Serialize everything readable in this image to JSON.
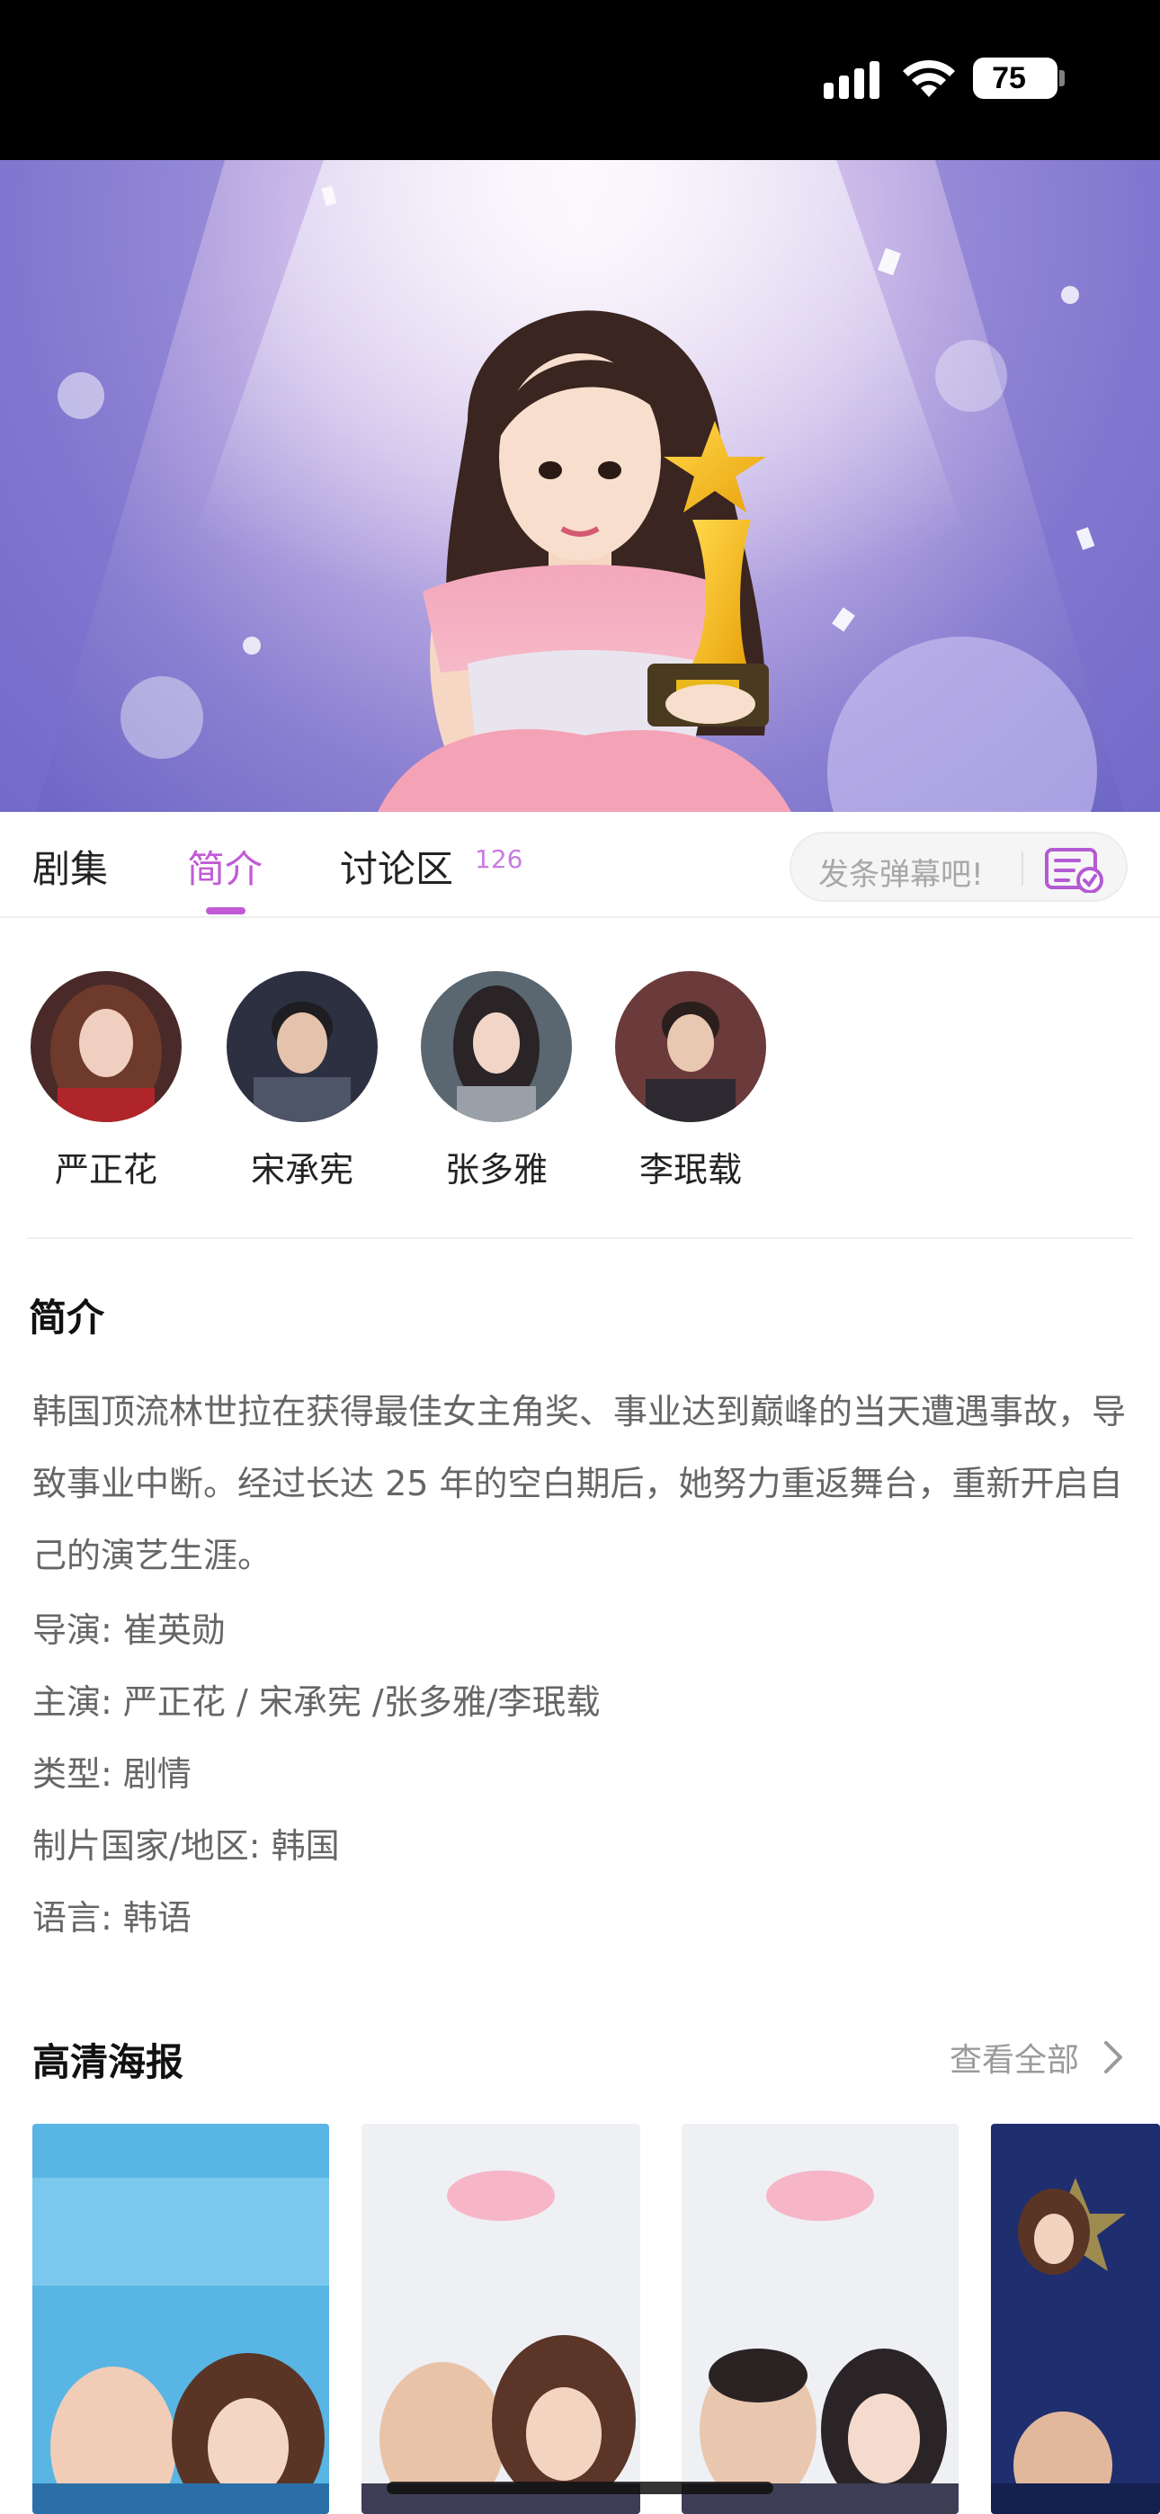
{
  "status_bar": {
    "battery": "75"
  },
  "tabs": {
    "episodes": "剧集",
    "intro": "简介",
    "discussion": "讨论区",
    "discussion_count": "126",
    "danmaku_placeholder": "发条弹幕吧!"
  },
  "cast": [
    "严正花",
    "宋承宪",
    "张多雅",
    "李珉载"
  ],
  "intro": {
    "title": "简介",
    "description": "韩国顶流林世拉在获得最佳女主角奖、事业达到巅峰的当天遭遇事故，导致事业中断。经过长达 25 年的空白期后，她努力重返舞台，重新开启自己的演艺生涯。",
    "director": "导演: 崔英勋",
    "starring": "主演: 严正花 / 宋承宪 /张多雅/李珉载",
    "genre": "类型: 剧情",
    "country": "制片国家/地区: 韩国",
    "language": "语言: 韩语"
  },
  "posters": {
    "title": "高清海报",
    "view_all": "查看全部"
  },
  "colors": {
    "accent": "#c25ad6",
    "muted": "#666666"
  }
}
